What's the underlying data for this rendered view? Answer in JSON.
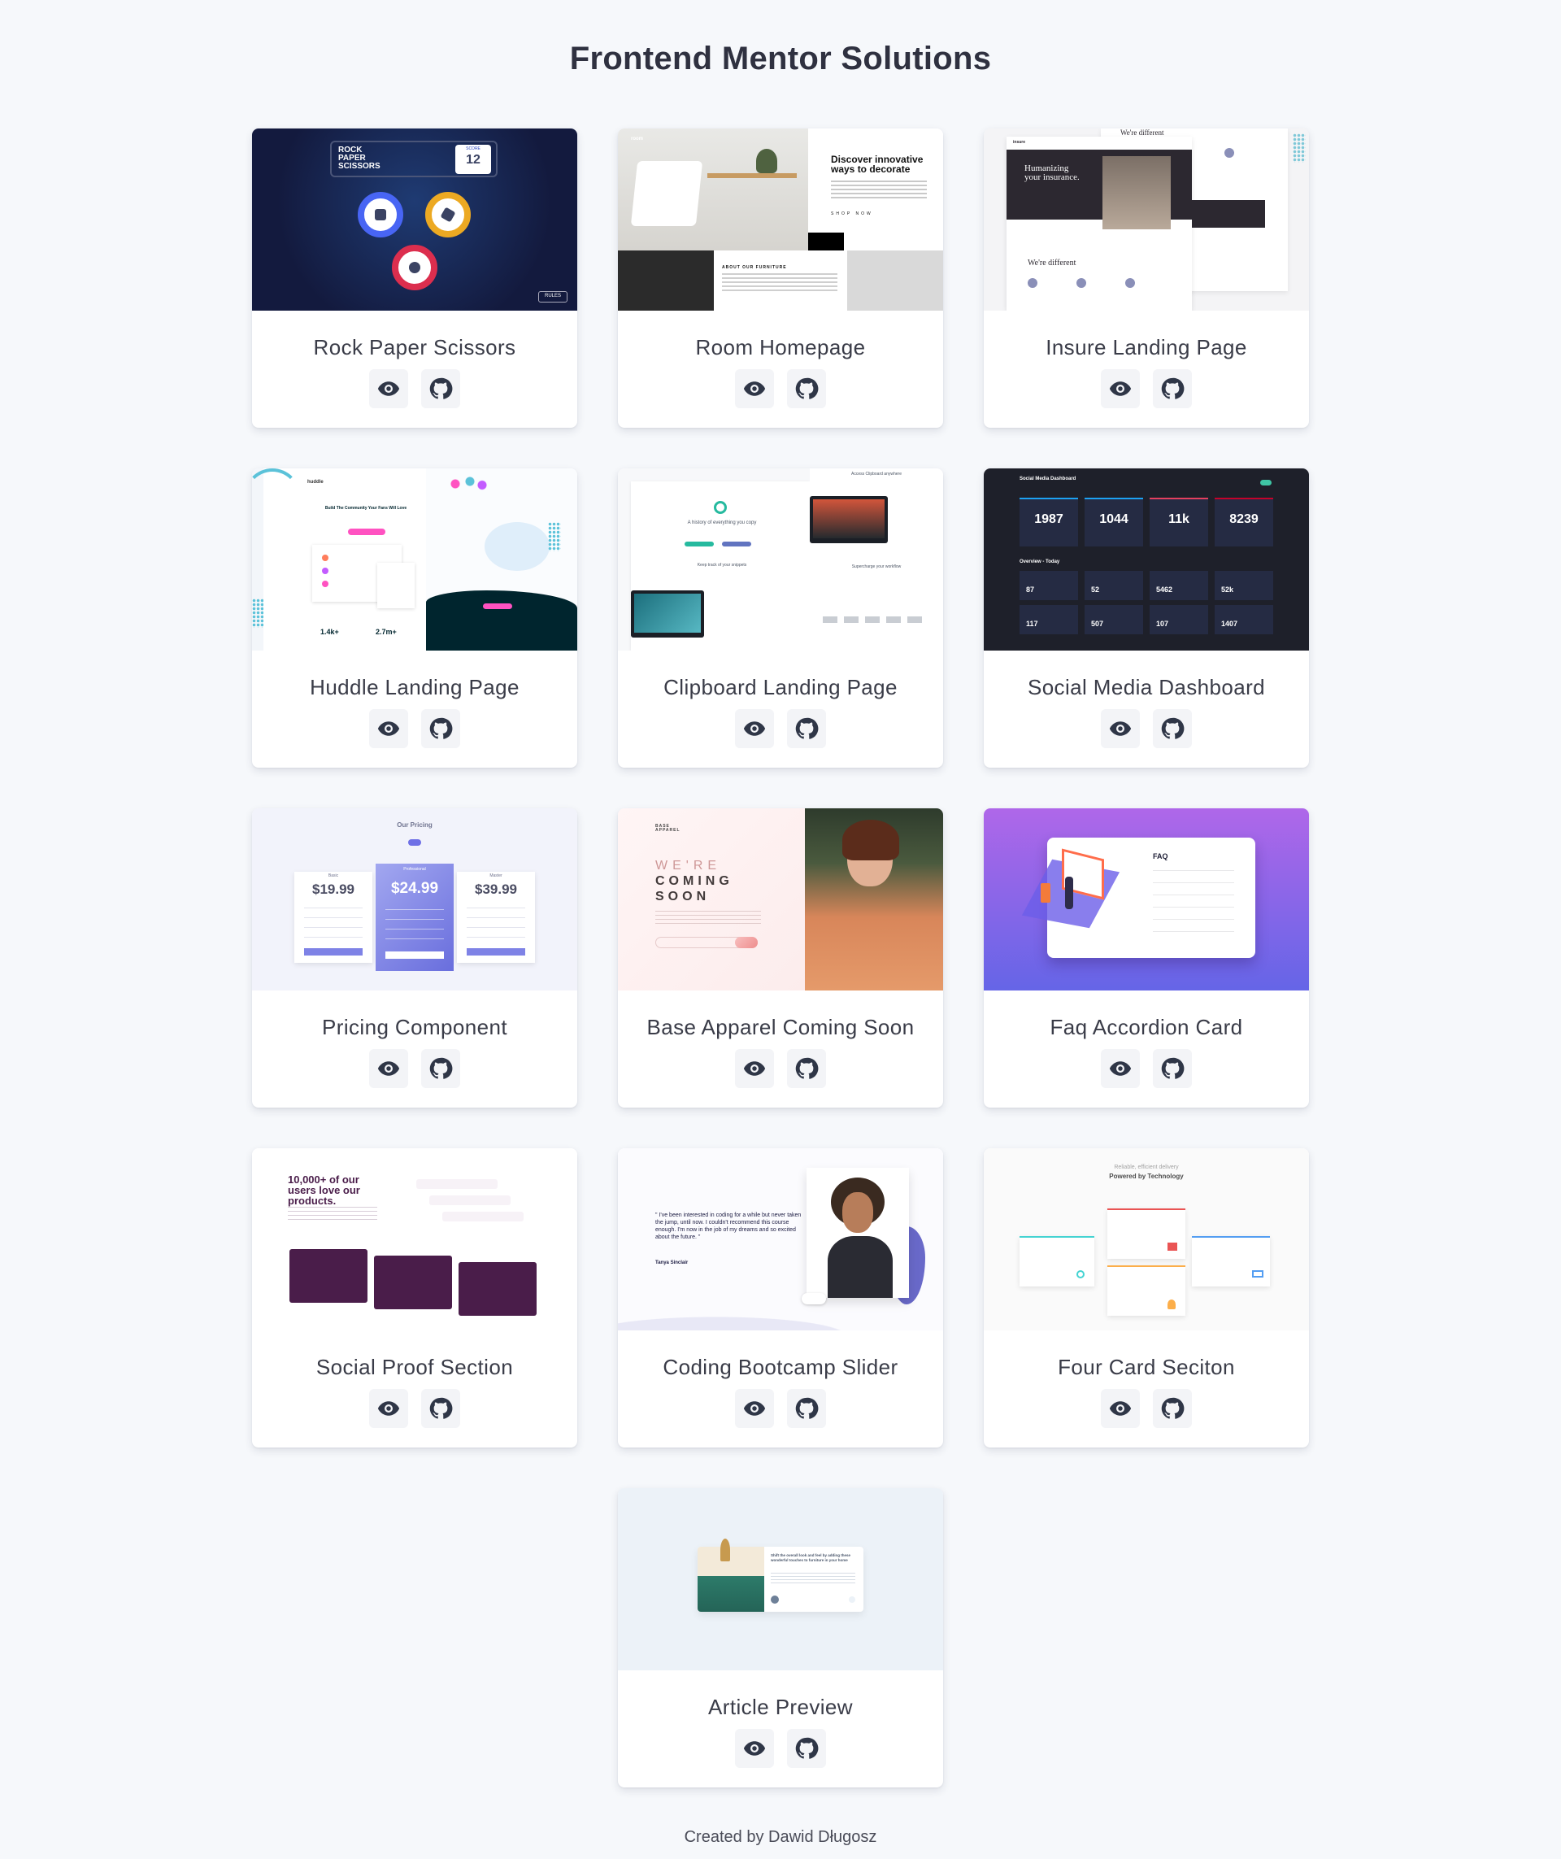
{
  "page": {
    "title": "Frontend Mentor Solutions"
  },
  "cards": [
    {
      "title": "Rock Paper Scissors",
      "preview_label": "Live preview",
      "code_label": "GitHub repository",
      "thumb": {
        "heading": "ROCK PAPER SCISSORS",
        "score_label": "SCORE",
        "score": "12",
        "rules": "RULES"
      }
    },
    {
      "title": "Room Homepage",
      "thumb": {
        "logo": "room",
        "heading": "Discover innovative ways to decorate",
        "cta": "SHOP NOW",
        "about": "ABOUT OUR FURNITURE"
      }
    },
    {
      "title": "Insure Landing Page",
      "thumb": {
        "logo": "insure",
        "heading": "Humanizing your insurance.",
        "sub": "We're different",
        "top": "We're different"
      }
    },
    {
      "title": "Huddle Landing Page",
      "thumb": {
        "logo": "huddle",
        "heading": "Build The Community Your Fans Will Love",
        "stat1": "1.4k+",
        "stat2": "2.7m+",
        "cta": "Ready To Build Your Community?"
      }
    },
    {
      "title": "Clipboard Landing Page",
      "thumb": {
        "heading": "A history of everything you copy",
        "sub": "Keep track of your snippets",
        "sub2": "Supercharge your workflow",
        "top": "Access Clipboard anywhere"
      }
    },
    {
      "title": "Social Media Dashboard",
      "thumb": {
        "heading": "Social Media Dashboard",
        "followers": [
          "1987",
          "1044",
          "11k",
          "8239"
        ],
        "overview": "Overview - Today",
        "stats": [
          "87",
          "52",
          "5462",
          "52k",
          "117",
          "507",
          "107",
          "1407"
        ]
      }
    },
    {
      "title": "Pricing Component",
      "thumb": {
        "heading": "Our Pricing",
        "prices": [
          "$19.99",
          "$24.99",
          "$39.99"
        ],
        "plans": [
          "Basic",
          "Professional",
          "Master"
        ]
      }
    },
    {
      "title": "Base Apparel Coming Soon",
      "thumb": {
        "logo": "BASE APPAREL",
        "line1": "WE'RE",
        "line2": "COMING",
        "line3": "SOON"
      }
    },
    {
      "title": "Faq Accordion Card",
      "thumb": {
        "heading": "FAQ"
      }
    },
    {
      "title": "Social Proof Section",
      "thumb": {
        "heading": "10,000+ of our users love our products."
      }
    },
    {
      "title": "Coding Bootcamp Slider",
      "thumb": {
        "quote": "\" I've been interested in coding for a while but never taken the jump, until now. I couldn't recommend this course enough. I'm now in the job of my dreams and so excited about the future. \"",
        "author": "Tanya Sinclair"
      }
    },
    {
      "title": "Four Card Seciton",
      "thumb": {
        "sub": "Reliable, efficient delivery",
        "heading": "Powered by Technology"
      }
    },
    {
      "title": "Article Preview",
      "thumb": {
        "heading": "Shift the overall look and feel by adding these wonderful touches to furniture in your home"
      }
    }
  ],
  "footer": {
    "text": "Created by Dawid Długosz"
  },
  "colors": {
    "background": "#f6f8fb",
    "card": "#ffffff",
    "button": "#f3f4f7",
    "icon": "#2f3647"
  }
}
